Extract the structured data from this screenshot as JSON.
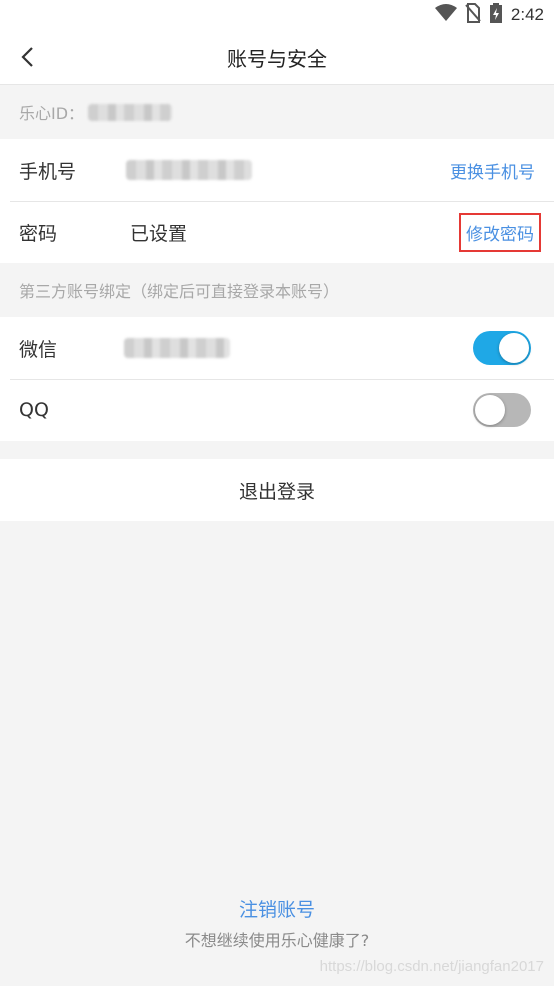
{
  "status_bar": {
    "time": "2:42"
  },
  "nav": {
    "title": "账号与安全"
  },
  "account_id": {
    "label": "乐心ID："
  },
  "phone": {
    "label": "手机号",
    "action": "更换手机号"
  },
  "password": {
    "label": "密码",
    "value": "已设置",
    "action": "修改密码"
  },
  "third_party": {
    "title": "第三方账号绑定（绑定后可直接登录本账号）",
    "wechat": {
      "label": "微信",
      "enabled": true
    },
    "qq": {
      "label": "QQ",
      "enabled": false
    }
  },
  "logout": {
    "label": "退出登录"
  },
  "footer": {
    "cancel_label": "注销账号",
    "hint": "不想继续使用乐心健康了?"
  },
  "watermark": "https://blog.csdn.net/jiangfan2017",
  "colors": {
    "accent": "#4a90e2",
    "toggle_on": "#1fa8e6",
    "highlight": "#e53935"
  }
}
